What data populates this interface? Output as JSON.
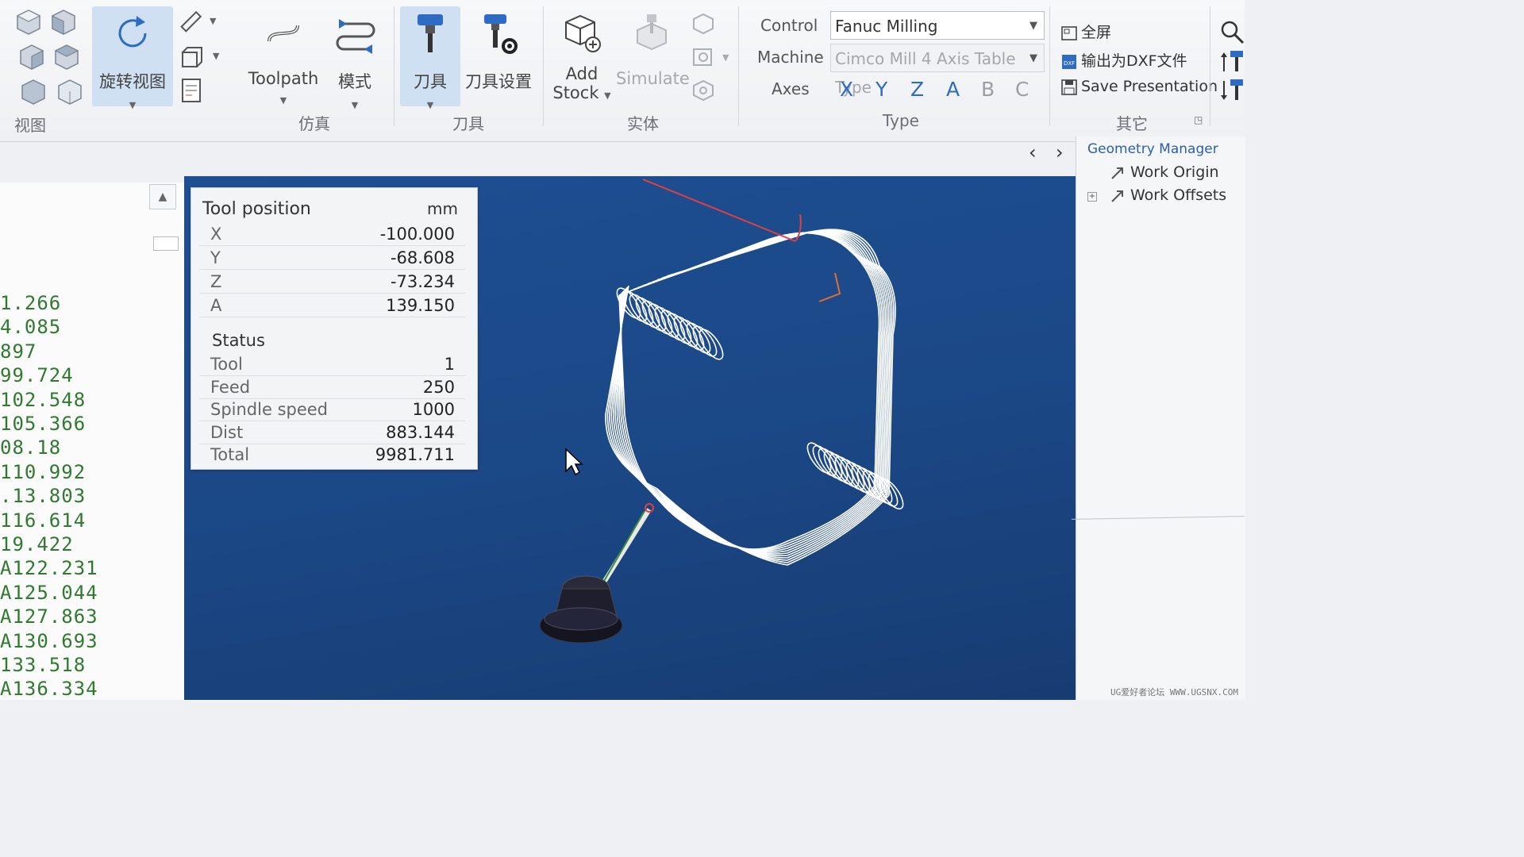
{
  "ribbon": {
    "view_group_label": "视图",
    "rotate_view_label": "旋转视图",
    "toolpath_label": "Toolpath",
    "mode_label": "模式",
    "sim_group_label": "仿真",
    "tool_label": "刀具",
    "tool_settings_label": "刀具设置",
    "tool_group_label": "刀具",
    "add_stock_line1": "Add",
    "add_stock_line2": "Stock",
    "simulate_label": "Simulate",
    "solid_group_label": "实体",
    "control_label": "Control",
    "control_value": "Fanuc Milling",
    "machine_label": "Machine",
    "machine_value": "Cimco Mill 4 Axis Table Type",
    "axes_label": "Axes",
    "axes": [
      "X",
      "Y",
      "Z",
      "A",
      "B",
      "C"
    ],
    "type_group_label": "Type",
    "fullscreen_label": "全屏",
    "export_dxf_label": "输出为DXF文件",
    "save_presentation_label": "Save Presentation",
    "other_group_label": "其它"
  },
  "code_lines": [
    "1.266",
    "4.085",
    "897",
    "99.724",
    "102.548",
    "105.366",
    "08.18",
    "110.992",
    ".13.803",
    "116.614",
    "19.422",
    "A122.231",
    "A125.044",
    "A127.863",
    "A130.693",
    "133.518",
    "A136.334"
  ],
  "tool_position": {
    "title": "Tool position",
    "unit": "mm",
    "rows": [
      {
        "k": "X",
        "v": "-100.000"
      },
      {
        "k": "Y",
        "v": "-68.608"
      },
      {
        "k": "Z",
        "v": "-73.234"
      },
      {
        "k": "A",
        "v": "139.150"
      }
    ],
    "status_title": "Status",
    "status_rows": [
      {
        "k": "Tool",
        "v": "1"
      },
      {
        "k": "Feed",
        "v": "250"
      },
      {
        "k": "Spindle speed",
        "v": "1000"
      },
      {
        "k": "Dist",
        "v": "883.144"
      },
      {
        "k": "Total",
        "v": "9981.711"
      }
    ]
  },
  "geometry_manager": {
    "title": "Geometry Manager",
    "items": [
      "Work Origin",
      "Work Offsets"
    ]
  },
  "watermark": "UG爱好者论坛 WWW.UGSNX.COM",
  "colors": {
    "accent": "#2e6cc4",
    "viewport": "#1d4b8c",
    "code_text": "#2f7a2f",
    "selected": "#cfe0f3"
  },
  "icons": [
    "cube-view-icon",
    "rotate-icon",
    "ruler-icon",
    "toolpath-icon",
    "mode-icon",
    "tool-icon",
    "tool-settings-icon",
    "add-stock-icon",
    "simulate-icon",
    "fullscreen-icon",
    "dxf-icon",
    "save-icon",
    "search-icon"
  ]
}
